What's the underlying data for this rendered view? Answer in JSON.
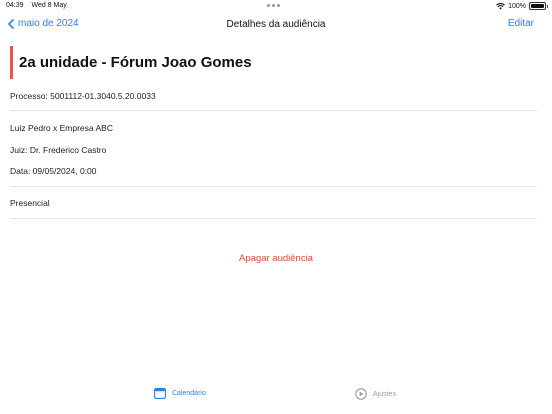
{
  "status": {
    "time": "04:39",
    "date": "Wed 8 May",
    "battery": "100%"
  },
  "nav": {
    "back_label": "maio de 2024",
    "title": "Detalhes da audiência",
    "edit_label": "Editar"
  },
  "hearing": {
    "title": "2a unidade - Fórum Joao Gomes",
    "process": "Processo: 5001112-01.3040.5.20.0033",
    "parties": "Luiz Pedro x Empresa ABC",
    "judge": "Juiz: Dr. Frederico Castro",
    "date": "Data: 09/05/2024, 0:00",
    "mode": "Presencial"
  },
  "actions": {
    "delete_label": "Apagar audiência"
  },
  "tabs": [
    {
      "label": "Calendário",
      "icon": "calendar-icon",
      "selected": true
    },
    {
      "label": "Ajustes",
      "icon": "settings-icon",
      "selected": false
    }
  ],
  "colors": {
    "accent": "#2f7ef0",
    "title_bar": "#e8583e",
    "destructive": "#e8453c"
  }
}
